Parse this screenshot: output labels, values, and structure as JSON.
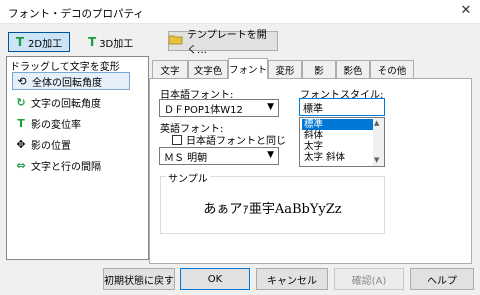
{
  "window": {
    "title": "フォント・デコのプロパティ",
    "close_glyph": "✕"
  },
  "toolbar": {
    "btn_2d": "2D加工",
    "btn_3d": "3D加工",
    "btn_template": "テンプレートを開く…"
  },
  "left": {
    "header": "ドラッグして文字を変形",
    "items": [
      {
        "label": "全体の回転角度",
        "icon": "rotate-icon",
        "selected": true
      },
      {
        "label": "文字の回転角度",
        "icon": "char-rotate-icon",
        "selected": false
      },
      {
        "label": "影の変位率",
        "icon": "shadow-offset-icon",
        "selected": false
      },
      {
        "label": "影の位置",
        "icon": "move-icon",
        "selected": false
      },
      {
        "label": "文字と行の間隔",
        "icon": "spacing-icon",
        "selected": false
      }
    ]
  },
  "tabs": [
    "文字",
    "文字色",
    "フォント",
    "変形",
    "影",
    "影色",
    "その他"
  ],
  "active_tab": "フォント",
  "font": {
    "jp_label": "日本語フォント:",
    "jp_value": "ＤＦPOP1体W12",
    "en_label": "英語フォント:",
    "same_as_jp": "日本語フォントと同じ",
    "en_value": "ＭＳ 明朝",
    "style_label": "フォントスタイル:",
    "style_value": "標準",
    "style_options": [
      "標準",
      "斜体",
      "太字",
      "太字 斜体"
    ],
    "sample_label": "サンプル",
    "sample_text": "あぁアｧ亜宇AaBbYyZz"
  },
  "footer": {
    "reset": "初期状態に戻す",
    "ok": "OK",
    "cancel": "キャンセル",
    "confirm": "確認(A)",
    "help": "ヘルプ"
  },
  "colors": {
    "accent": "#0078d7",
    "icon_green": "#1a9e3a"
  }
}
